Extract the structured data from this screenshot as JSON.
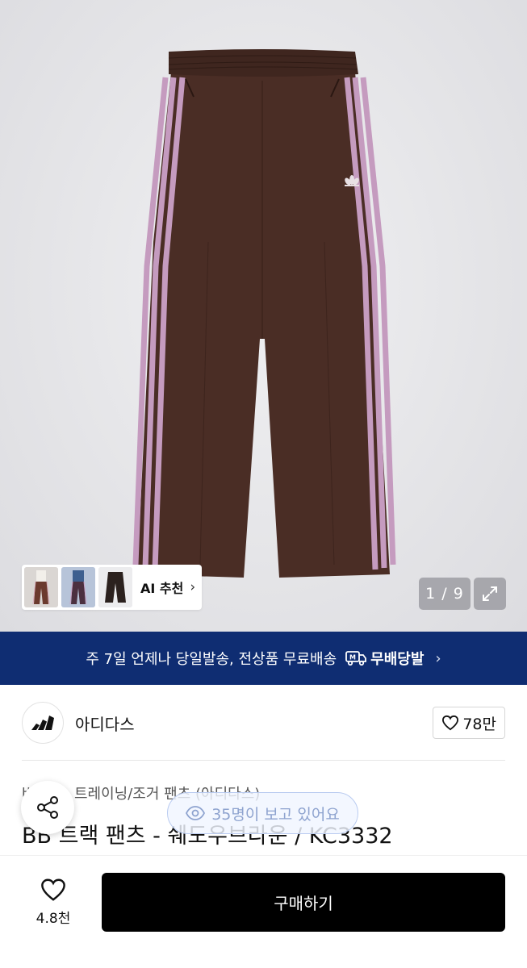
{
  "gallery": {
    "counter": "1 / 9",
    "ai_recommend_label": "AI 추천",
    "thumbnails": [
      "thumb-model-front",
      "thumb-model-back",
      "thumb-product-flat"
    ]
  },
  "banner": {
    "text": "주 7일 언제나 당일발송, 전상품 무료배송",
    "logo_text": "무배당발",
    "background": "#0f2d72"
  },
  "brand": {
    "name": "아디다스",
    "like_count": "78만"
  },
  "product": {
    "category_prefix": "바지",
    "category": "트레이닝/조거 팬츠 (아디다스)",
    "title": "BB 트랙 팬츠 - 쉐도우브라운 / KC3332",
    "viewers": "35명이 보고 있어요"
  },
  "bottom": {
    "wish_count": "4.8천",
    "buy_label": "구매하기"
  },
  "colors": {
    "pants_brown": "#4a2d25",
    "stripe_pink": "#c59bbf",
    "buy_button": "#000000"
  },
  "icons": [
    "adidas-logo-icon",
    "heart-icon",
    "share-icon",
    "eye-icon",
    "expand-icon",
    "chevron-right-icon",
    "delivery-truck-icon"
  ]
}
